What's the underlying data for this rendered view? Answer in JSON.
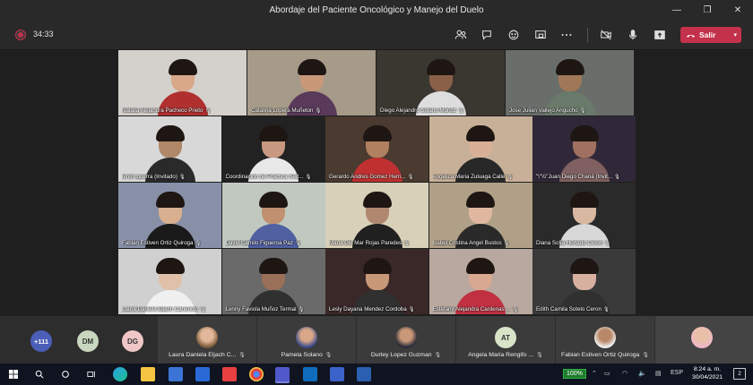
{
  "window": {
    "title": "Abordaje del Paciente Oncológico y Manejo del Duelo",
    "minimize": "—",
    "maximize": "❐",
    "close": "✕"
  },
  "toolbar": {
    "timer": "34:33",
    "leave_label": "Salir",
    "leave_chevron": "▾",
    "leave_color": "#c4314b",
    "icons": [
      "participants-icon",
      "chat-icon",
      "reactions-icon",
      "share-tray-icon",
      "more-icon",
      "camera-off-icon",
      "mic-icon",
      "share-screen-icon"
    ]
  },
  "tiles": [
    {
      "name": "Natalia Alejandra Pacheco Prieto"
    },
    {
      "name": "Catalina Lopera Muñeton"
    },
    {
      "name": "Diego Alejandro Solano Muñoz"
    },
    {
      "name": "Jose Julian Vallejo Angucho"
    },
    {
      "name": "lenim guerra (Invitado)"
    },
    {
      "name": "Coordinación de Práctica Sed..."
    },
    {
      "name": "Gerardo Andres Gomez Hern..."
    },
    {
      "name": "Angelica Maria Zuluaga Calle"
    },
    {
      "name": "\"\\\"\\\\\\\"Juan Diego Chaná (Invit..."
    },
    {
      "name": "Fabian Estiven Ortiz Quiroga"
    },
    {
      "name": "David Camilo Figueroa Paz"
    },
    {
      "name": "Maria Del Mar Rojas Paredes"
    },
    {
      "name": "Isabel Cristina Angel Bustos"
    },
    {
      "name": "Diana Sofia Hurtado Ceron"
    },
    {
      "name": "Laura Daniela Eljach Canencio"
    },
    {
      "name": "Lenny Faviola Muñoz Termal"
    },
    {
      "name": "Lesly Dayana Mendez Cordoba"
    },
    {
      "name": "Estefany Alejandra Cardenas ..."
    },
    {
      "name": "Edith Camila Sotelo Ceron"
    }
  ],
  "roster": {
    "more_count": "+111",
    "initials": [
      {
        "text": "DM",
        "color": "#c8d8c0"
      },
      {
        "text": "DG",
        "color": "#f0c6c6"
      }
    ],
    "cards": [
      {
        "name": "Laura Daniela Eljach C..."
      },
      {
        "name": "Pamela Solano"
      },
      {
        "name": "Durley Lopez Guzman"
      },
      {
        "name": "Angela Maria Rengifo ...",
        "initials": "AT"
      },
      {
        "name": "Fabian Estiven Ortiz Quiroga"
      }
    ]
  },
  "taskbar": {
    "battery": "100%",
    "lang": "ESP",
    "time": "8:24 a. m.",
    "date": "30/04/2021",
    "notifications": "2"
  }
}
